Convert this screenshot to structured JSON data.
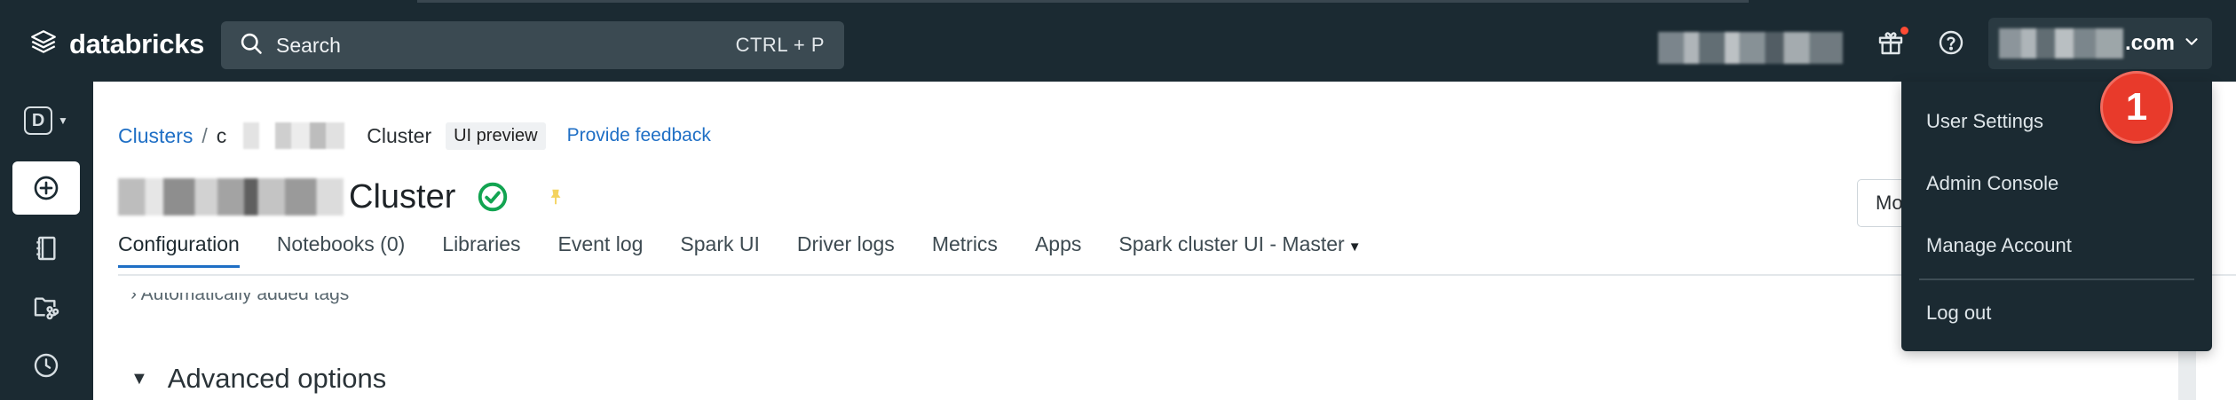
{
  "topbar": {
    "logo_text": "databricks",
    "search_placeholder": "Search",
    "search_shortcut": "CTRL + P",
    "account_domain": ".com"
  },
  "icons": {
    "logo": "databricks-logo-icon",
    "search": "search-icon",
    "gift": "gift-icon",
    "help": "help-icon",
    "account_caret": "chevron-down-icon"
  },
  "rail": {
    "workspace_letter": "D",
    "items": [
      "create-icon",
      "workspace-icon",
      "repos-icon",
      "recents-icon"
    ]
  },
  "breadcrumb": {
    "root": "Clusters",
    "separator": "/",
    "prefix": "c",
    "current": "Cluster",
    "badge": "UI preview",
    "feedback": "Provide feedback"
  },
  "title": {
    "suffix": "Cluster",
    "status": "running"
  },
  "more_button": "Mo",
  "tabs": [
    {
      "label": "Configuration",
      "active": true
    },
    {
      "label": "Notebooks (0)"
    },
    {
      "label": "Libraries"
    },
    {
      "label": "Event log"
    },
    {
      "label": "Spark UI"
    },
    {
      "label": "Driver logs"
    },
    {
      "label": "Metrics"
    },
    {
      "label": "Apps"
    },
    {
      "label": "Spark cluster UI - Master"
    }
  ],
  "content": {
    "auto_tags": "› Automatically added tags",
    "advanced_options": "Advanced options"
  },
  "user_menu": {
    "items": [
      "User Settings",
      "Admin Console",
      "Manage Account",
      "Log out"
    ]
  },
  "annotation": {
    "step_number": "1"
  },
  "colors": {
    "topbar_bg": "#1b2a32",
    "link": "#1f6fc5",
    "status_green": "#12a451",
    "step_badge": "#e83a2b"
  }
}
